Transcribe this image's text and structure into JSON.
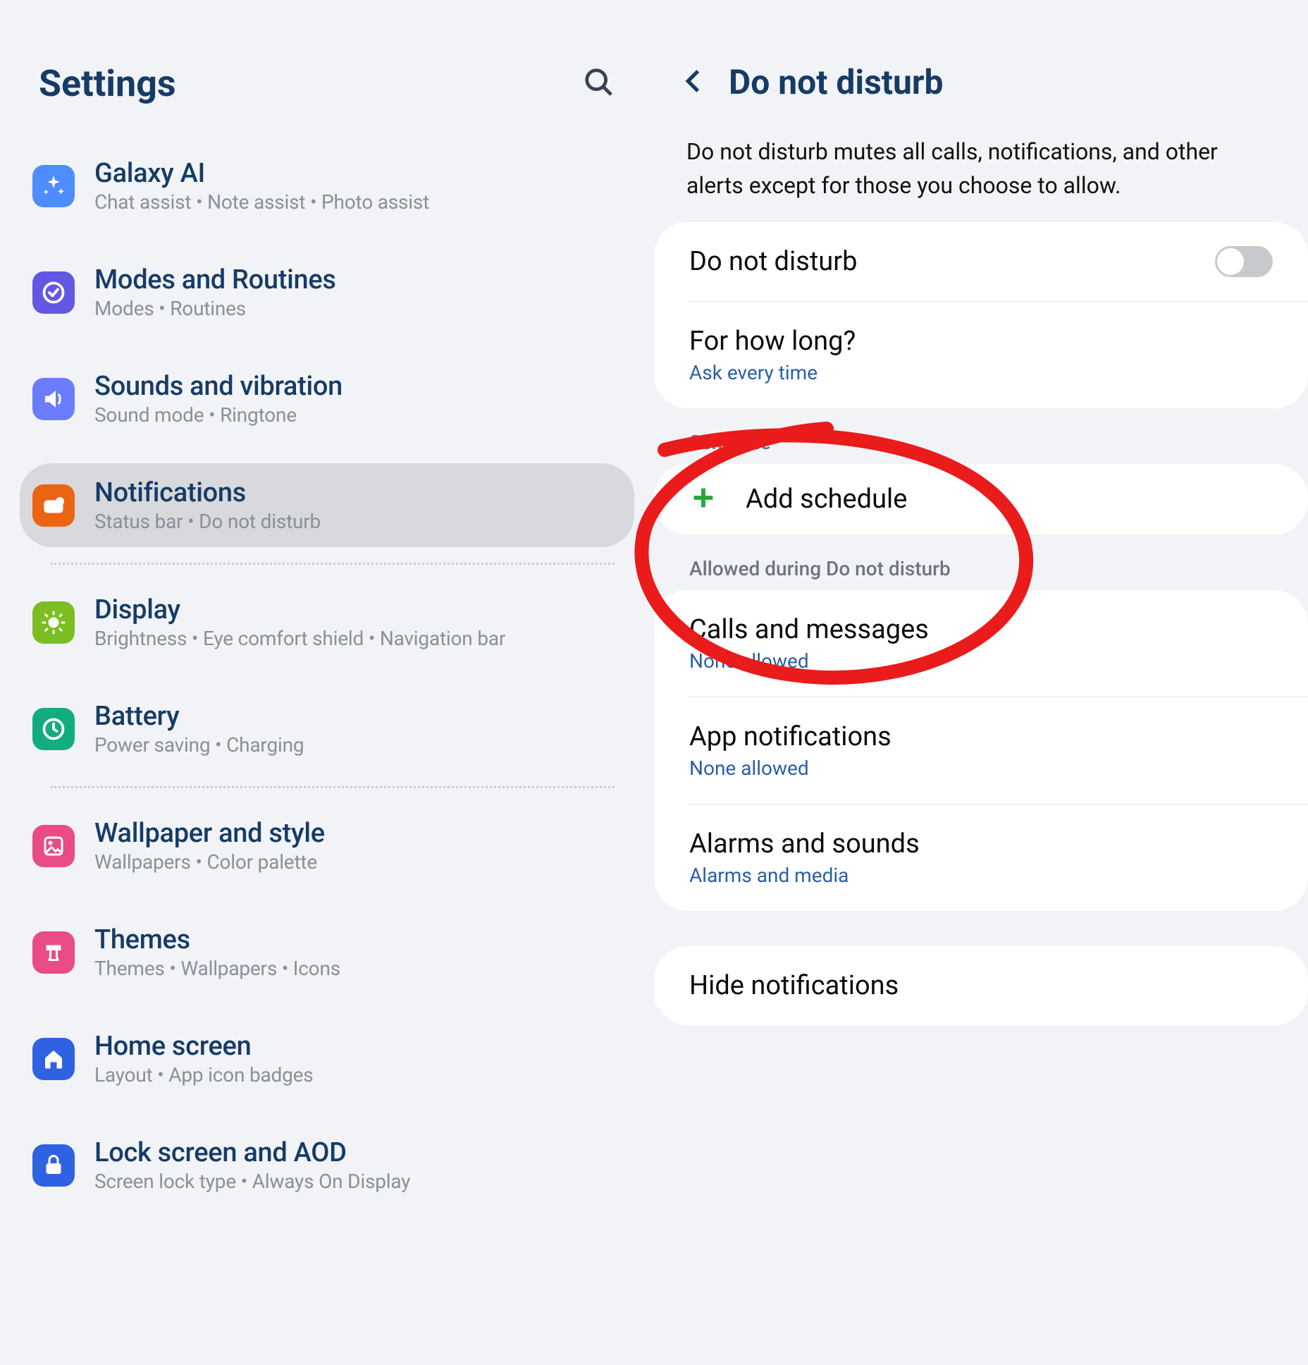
{
  "header": {
    "title": "Settings"
  },
  "sidebar": {
    "items": [
      {
        "title": "Galaxy AI",
        "sub": "Chat assist  •  Note assist  •  Photo assist"
      },
      {
        "title": "Modes and Routines",
        "sub": "Modes  •  Routines"
      },
      {
        "title": "Sounds and vibration",
        "sub": "Sound mode  •  Ringtone"
      },
      {
        "title": "Notifications",
        "sub": "Status bar  •  Do not disturb"
      },
      {
        "title": "Display",
        "sub": "Brightness  •  Eye comfort shield  •  Navigation bar"
      },
      {
        "title": "Battery",
        "sub": "Power saving  •  Charging"
      },
      {
        "title": "Wallpaper and style",
        "sub": "Wallpapers  •  Color palette"
      },
      {
        "title": "Themes",
        "sub": "Themes  •  Wallpapers  •  Icons"
      },
      {
        "title": "Home screen",
        "sub": "Layout  •  App icon badges"
      },
      {
        "title": "Lock screen and AOD",
        "sub": "Screen lock type  •  Always On Display"
      }
    ]
  },
  "detail": {
    "title": "Do not disturb",
    "desc": "Do not disturb mutes all calls, notifications, and other alerts except for those you choose to allow.",
    "dnd_label": "Do not disturb",
    "dnd_on": false,
    "howlong_title": "For how long?",
    "howlong_value": "Ask every time",
    "schedule_label": "Schedule",
    "add_schedule": "Add schedule",
    "allowed_label": "Allowed during Do not disturb",
    "calls_title": "Calls and messages",
    "calls_sub": "None allowed",
    "appnotif_title": "App notifications",
    "appnotif_sub": "None allowed",
    "alarms_title": "Alarms and sounds",
    "alarms_sub": "Alarms and media",
    "hide_title": "Hide notifications"
  }
}
